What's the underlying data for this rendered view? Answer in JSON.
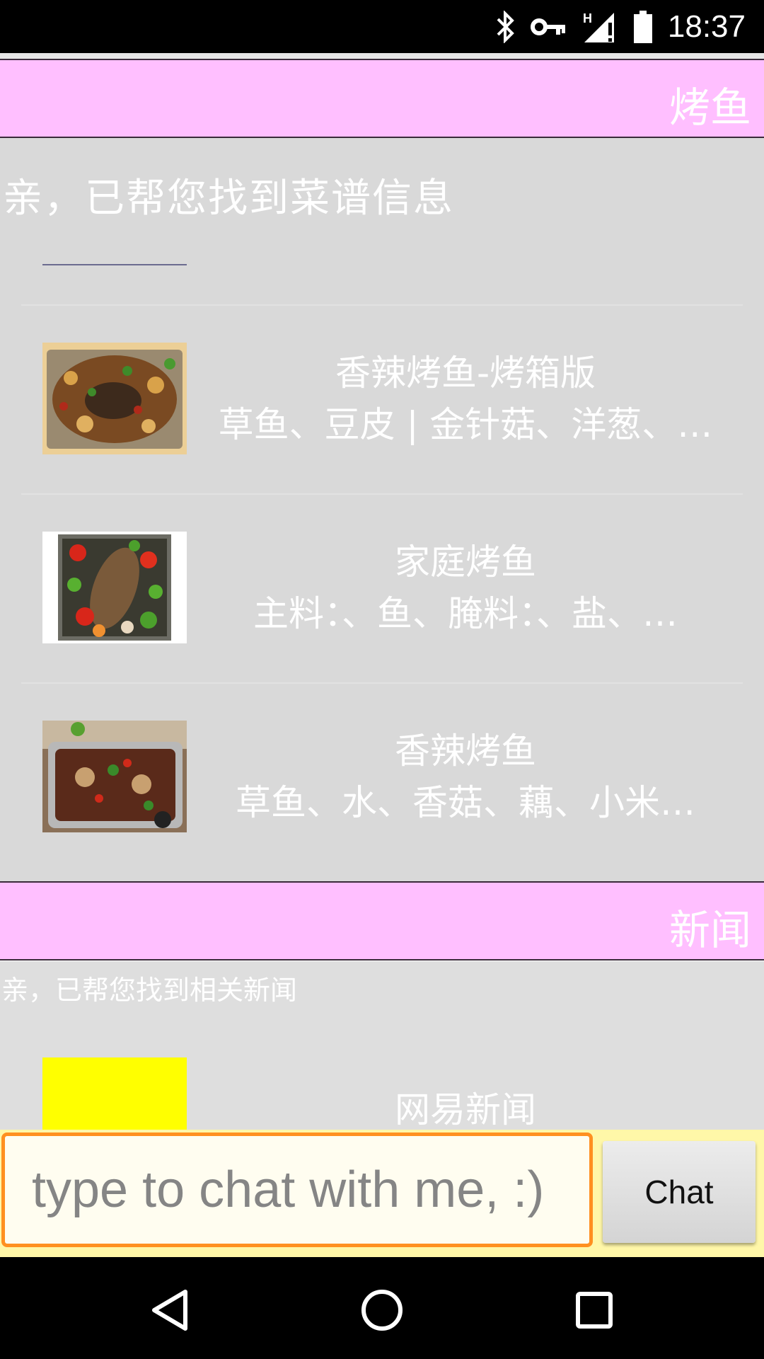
{
  "status_bar": {
    "time": "18:37",
    "icons": [
      "bluetooth-icon",
      "vpn-key-icon",
      "signal-h-icon",
      "battery-icon"
    ]
  },
  "sections": [
    {
      "title": "烤鱼",
      "intro": "亲，已帮您找到菜谱信息",
      "recipes": [
        {
          "name": "香辣烤鱼-烤箱版",
          "ingredients": "草鱼、豆皮 | 金针菇、洋葱、…"
        },
        {
          "name": "家庭烤鱼",
          "ingredients": "主料：、鱼、腌料：、盐、…"
        },
        {
          "name": "香辣烤鱼",
          "ingredients": "草鱼、水、香菇、藕、小米…"
        }
      ]
    },
    {
      "title": "新闻",
      "intro": "亲，已帮您找到相关新闻",
      "news": [
        {
          "name": "网易新闻"
        }
      ]
    }
  ],
  "input": {
    "placeholder": "type to chat with me, :)",
    "button_label": "Chat"
  },
  "nav": [
    "back-icon",
    "home-icon",
    "recents-icon"
  ],
  "colors": {
    "header_bg": "#ffbfff",
    "card_bg": "#d9d9d9",
    "input_border": "#ff9020",
    "input_area_bg": "#fff7a8",
    "news_thumb": "#ffff00"
  }
}
